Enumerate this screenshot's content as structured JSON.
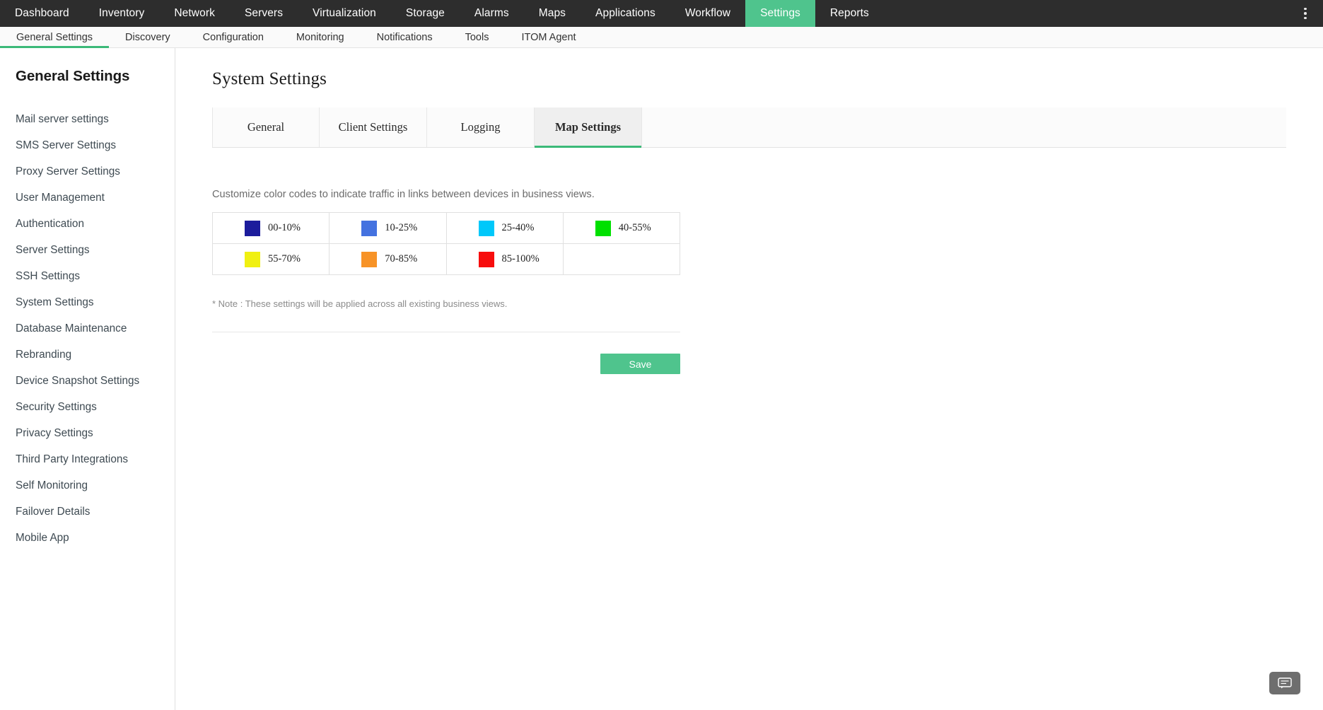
{
  "topnav": {
    "items": [
      {
        "label": "Dashboard",
        "active": false
      },
      {
        "label": "Inventory",
        "active": false
      },
      {
        "label": "Network",
        "active": false
      },
      {
        "label": "Servers",
        "active": false
      },
      {
        "label": "Virtualization",
        "active": false
      },
      {
        "label": "Storage",
        "active": false
      },
      {
        "label": "Alarms",
        "active": false
      },
      {
        "label": "Maps",
        "active": false
      },
      {
        "label": "Applications",
        "active": false
      },
      {
        "label": "Workflow",
        "active": false
      },
      {
        "label": "Settings",
        "active": true
      },
      {
        "label": "Reports",
        "active": false
      }
    ],
    "overflow_icon": "kebab-menu-icon",
    "active_color": "#4FC48D",
    "background": "#2d2d2d"
  },
  "subnav": {
    "items": [
      {
        "label": "General Settings",
        "active": true
      },
      {
        "label": "Discovery",
        "active": false
      },
      {
        "label": "Configuration",
        "active": false
      },
      {
        "label": "Monitoring",
        "active": false
      },
      {
        "label": "Notifications",
        "active": false
      },
      {
        "label": "Tools",
        "active": false
      },
      {
        "label": "ITOM Agent",
        "active": false
      }
    ],
    "active_underline_color": "#3BB978"
  },
  "sidebar": {
    "title": "General Settings",
    "items": [
      {
        "label": "Mail server settings"
      },
      {
        "label": "SMS Server Settings"
      },
      {
        "label": "Proxy Server Settings"
      },
      {
        "label": "User Management"
      },
      {
        "label": "Authentication"
      },
      {
        "label": "Server Settings"
      },
      {
        "label": "SSH Settings"
      },
      {
        "label": "System Settings"
      },
      {
        "label": "Database Maintenance"
      },
      {
        "label": "Rebranding"
      },
      {
        "label": "Device Snapshot Settings"
      },
      {
        "label": "Security Settings"
      },
      {
        "label": "Privacy Settings"
      },
      {
        "label": "Third Party Integrations"
      },
      {
        "label": "Self Monitoring"
      },
      {
        "label": "Failover Details"
      },
      {
        "label": "Mobile App"
      }
    ]
  },
  "main": {
    "page_title": "System Settings",
    "tabs": [
      {
        "label": "General",
        "active": false
      },
      {
        "label": "Client Settings",
        "active": false
      },
      {
        "label": "Logging",
        "active": false
      },
      {
        "label": "Map Settings",
        "active": true
      }
    ],
    "description": "Customize color codes to indicate traffic in links between devices in business views.",
    "color_codes": [
      [
        {
          "color": "#1C1C9C",
          "label": "00-10%"
        },
        {
          "color": "#4472E0",
          "label": "10-25%"
        },
        {
          "color": "#00C8FA",
          "label": "25-40%"
        },
        {
          "color": "#00E000",
          "label": "40-55%"
        }
      ],
      [
        {
          "color": "#F0F011",
          "label": "55-70%"
        },
        {
          "color": "#F79327",
          "label": "70-85%"
        },
        {
          "color": "#F70D0D",
          "label": "85-100%"
        },
        {
          "color": "",
          "label": ""
        }
      ]
    ],
    "note": "* Note : These settings will be applied across all existing business views.",
    "save_label": "Save",
    "save_color": "#4FC48D"
  },
  "chat": {
    "icon": "chat-bubble-icon"
  }
}
